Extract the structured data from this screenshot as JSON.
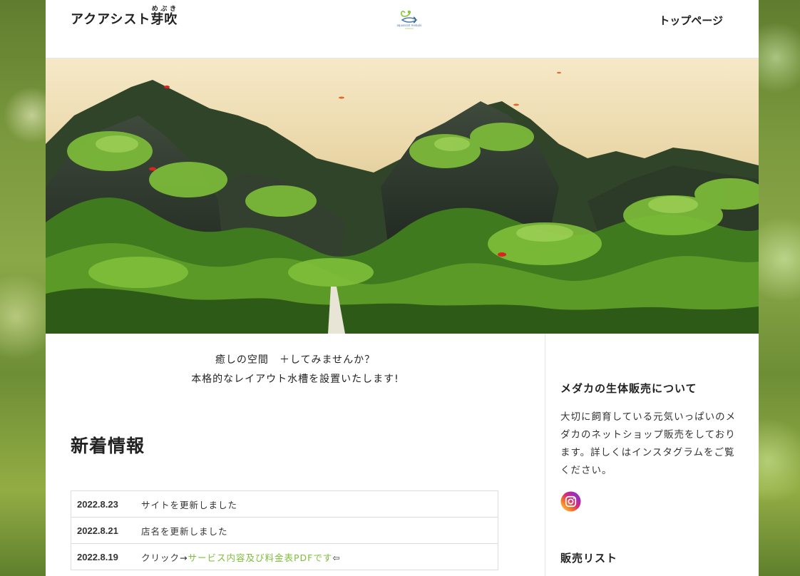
{
  "header": {
    "site_title": "アクアシスト芽吹",
    "site_title_base": "アクアシスト",
    "site_title_kanji": "芽吹",
    "site_title_ruby": "めぶき",
    "logo_text": "aquassist mebuki",
    "nav_top": "トップページ"
  },
  "main": {
    "intro_line1": "癒しの空間　＋してみませんか？",
    "intro_line2": "本格的なレイアウト水槽を設置いたします!",
    "news_title": "新着情報",
    "news": [
      {
        "date": "2022.8.23",
        "text": "サイトを更新しました"
      },
      {
        "date": "2022.8.21",
        "text": "店名を更新しました"
      },
      {
        "date": "2022.8.19",
        "prefix": "クリック→",
        "link": "サービス内容及び料金表PDFです",
        "suffix": "⇦"
      }
    ]
  },
  "sidebar": {
    "title": "メダカの生体販売について",
    "text": "大切に飼育している元気いっぱいのメダカのネットショップ販売をしております。詳しくはインスタグラムをご覧ください。",
    "instagram_icon": "instagram-icon",
    "title2": "販売リスト"
  },
  "colors": {
    "link": "#7cbf3a",
    "instagram_gradient": [
      "#feda75",
      "#fa7e1e",
      "#d62976",
      "#962fbf",
      "#4f5bd5"
    ]
  }
}
